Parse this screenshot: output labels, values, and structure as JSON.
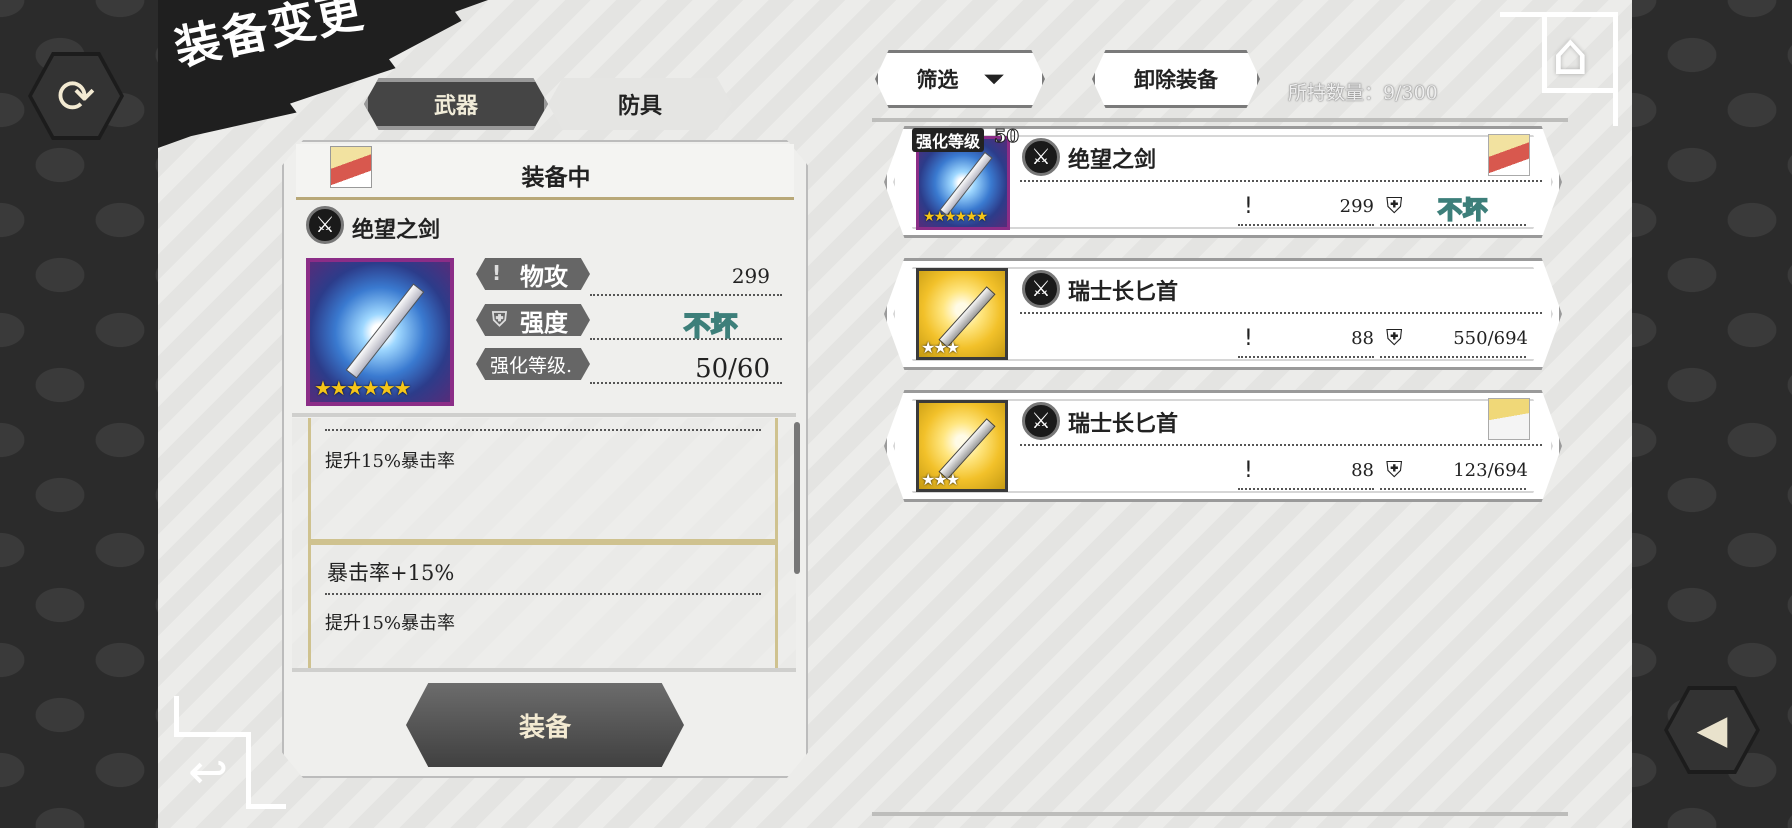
{
  "screen_title": "装备变更",
  "tabs": [
    {
      "label": "武器",
      "active": true
    },
    {
      "label": "防具",
      "active": false
    }
  ],
  "equipped": {
    "header": "装备中",
    "name": "绝望之剑",
    "rarity_stars": "★★★★★★",
    "stats": {
      "attack_label": "物攻",
      "attack_value": "299",
      "durability_label": "强度",
      "durability_value": "不坏",
      "enhance_label": "强化等级.",
      "enhance_value": "50/60"
    },
    "skills": [
      {
        "title": "",
        "desc": "提升15%暴击率"
      },
      {
        "title": "暴击率+15%",
        "desc": "提升15%暴击率"
      }
    ],
    "equip_button": "装备"
  },
  "toolbar": {
    "filter_label": "筛选",
    "unequip_label": "卸除装备",
    "count_text": "所持数量：9/300"
  },
  "items": [
    {
      "name": "绝望之剑",
      "enhance_badge": "强化等级",
      "enhance_level": "50",
      "attack": "299",
      "durability": "不坏",
      "stars": "★★★★★★",
      "tile": "rainbow",
      "has_avatar": true
    },
    {
      "name": "瑞士长匕首",
      "attack": "88",
      "durability": "550/694",
      "stars": "★★★",
      "tile": "gold",
      "has_avatar": false
    },
    {
      "name": "瑞士长匕首",
      "attack": "88",
      "durability": "123/694",
      "stars": "★★★",
      "tile": "gold",
      "has_avatar": true
    }
  ],
  "icons": {
    "refresh": "⟳",
    "home": "⌂",
    "back": "↩",
    "sound": "◀",
    "sword": "⚔",
    "attack": "!",
    "durability": "⛨",
    "filter": "⏷"
  },
  "colors": {
    "accent_gold": "#cfc28f",
    "unbreak_teal": "#3d7f7a",
    "dark": "#1f1f1f"
  }
}
